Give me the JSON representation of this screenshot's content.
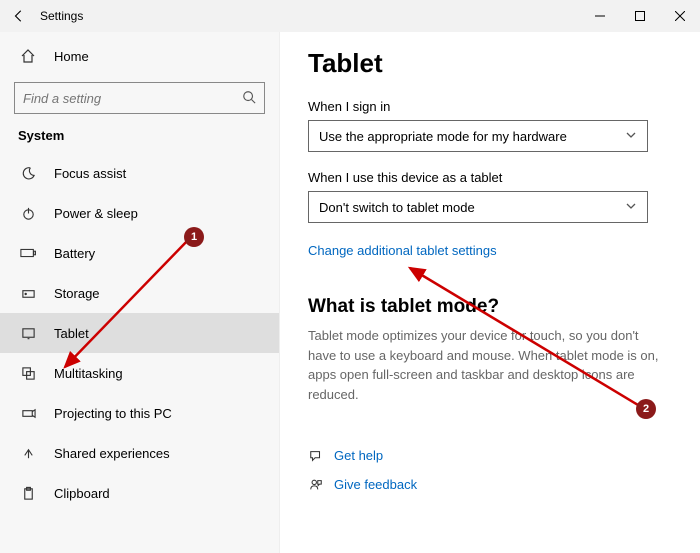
{
  "window": {
    "title": "Settings"
  },
  "sidebar": {
    "home": "Home",
    "search_placeholder": "Find a setting",
    "section": "System",
    "items": [
      {
        "label": "Focus assist"
      },
      {
        "label": "Power & sleep"
      },
      {
        "label": "Battery"
      },
      {
        "label": "Storage"
      },
      {
        "label": "Tablet"
      },
      {
        "label": "Multitasking"
      },
      {
        "label": "Projecting to this PC"
      },
      {
        "label": "Shared experiences"
      },
      {
        "label": "Clipboard"
      }
    ]
  },
  "page": {
    "title": "Tablet",
    "signin_label": "When I sign in",
    "signin_value": "Use the appropriate mode for my hardware",
    "tabletuse_label": "When I use this device as a tablet",
    "tabletuse_value": "Don't switch to tablet mode",
    "additional_link": "Change additional tablet settings",
    "what_header": "What is tablet mode?",
    "what_body": "Tablet mode optimizes your device for touch, so you don't have to use a keyboard and mouse. When tablet mode is on, apps open full-screen and taskbar and desktop icons are reduced.",
    "get_help": "Get help",
    "give_feedback": "Give feedback"
  },
  "annotations": {
    "one": "1",
    "two": "2"
  }
}
